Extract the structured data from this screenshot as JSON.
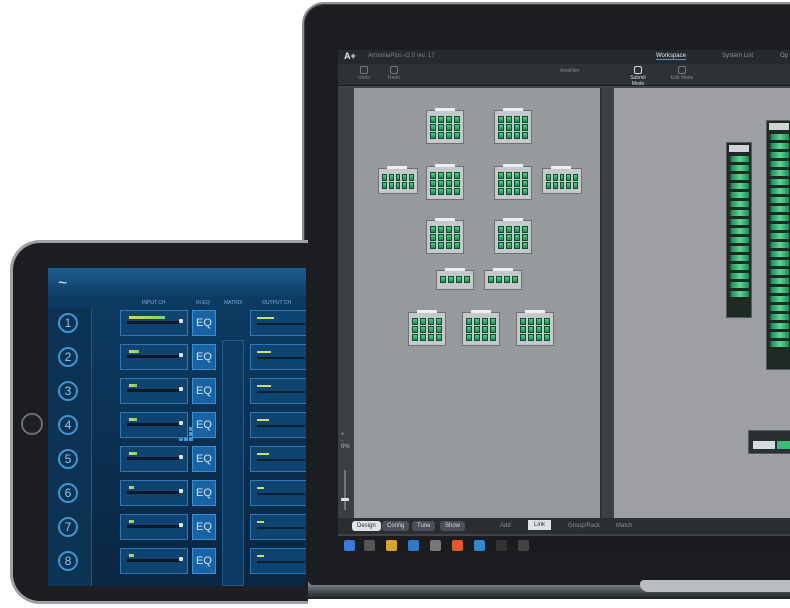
{
  "laptop": {
    "titlebar": {
      "logo": "A+",
      "file": "ArmoniaPlus v2.0 rev. 17",
      "tabs": [
        "Workspace",
        "System List",
        "Op"
      ]
    },
    "toolbar": {
      "tools": [
        "Undo",
        "Redo",
        "Submit Mode",
        "Edit Mode"
      ],
      "amplifier_label": "Amplifier"
    },
    "zoom": {
      "zoom_in": "+",
      "zoom_out": "-",
      "percent": "0%"
    },
    "modebar": {
      "modes": [
        "Design",
        "Config",
        "Tune",
        "Show"
      ],
      "actions": [
        "Add",
        "Link",
        "Group/Rack",
        "Match"
      ]
    },
    "taskbar": {
      "apps": [
        "start",
        "search",
        "files",
        "mail",
        "store",
        "browser",
        "chrome",
        "a1",
        "a2"
      ]
    }
  },
  "tablet": {
    "logo": "~",
    "headers": {
      "input": "INPUT CH",
      "in_eq": "IN EQ",
      "matrix": "MATRIX",
      "output": "OUTPUT CH"
    },
    "channels": [
      "1",
      "2",
      "3",
      "4",
      "5",
      "6",
      "7",
      "8"
    ],
    "eq_label": "EQ",
    "input_levels": [
      0.7,
      0.2,
      0.15,
      0.15,
      0.15,
      0.1,
      0.1,
      0.1
    ],
    "output_levels": [
      0.35,
      0.3,
      0.3,
      0.25,
      0.25,
      0.15,
      0.15,
      0.15
    ]
  },
  "colors": {
    "amp_green": "#3bbd78",
    "tablet_blue": "#0e3d66",
    "accent_blue": "#3f94d6",
    "canvas_gray": "#979a9d"
  }
}
